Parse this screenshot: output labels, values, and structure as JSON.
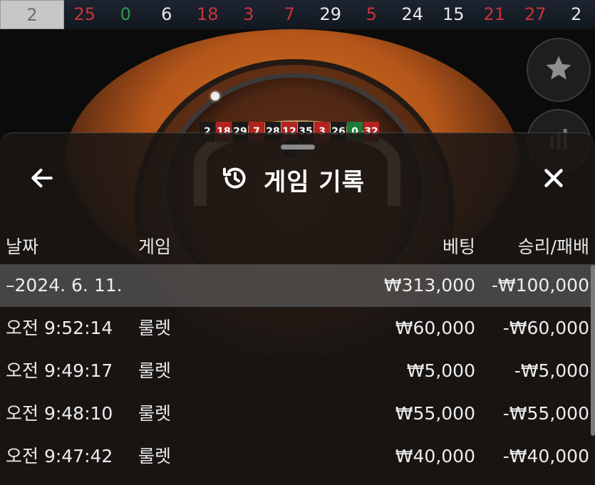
{
  "results_strip": {
    "numbers": [
      {
        "value": "2",
        "color": "grey"
      },
      {
        "value": "25",
        "color": "red"
      },
      {
        "value": "0",
        "color": "green"
      },
      {
        "value": "6",
        "color": "white"
      },
      {
        "value": "18",
        "color": "red"
      },
      {
        "value": "3",
        "color": "red"
      },
      {
        "value": "7",
        "color": "red"
      },
      {
        "value": "29",
        "color": "white"
      },
      {
        "value": "5",
        "color": "red"
      },
      {
        "value": "24",
        "color": "white"
      },
      {
        "value": "15",
        "color": "white"
      },
      {
        "value": "21",
        "color": "red"
      },
      {
        "value": "27",
        "color": "red"
      },
      {
        "value": "2",
        "color": "white"
      }
    ]
  },
  "wheel": {
    "pockets": [
      {
        "n": "2",
        "c": "b"
      },
      {
        "n": "18",
        "c": "r"
      },
      {
        "n": "29",
        "c": "b"
      },
      {
        "n": "7",
        "c": "r"
      },
      {
        "n": "28",
        "c": "b"
      },
      {
        "n": "12",
        "c": "r"
      },
      {
        "n": "35",
        "c": "b"
      },
      {
        "n": "3",
        "c": "r"
      },
      {
        "n": "26",
        "c": "b"
      },
      {
        "n": "0",
        "c": "g"
      },
      {
        "n": "32",
        "c": "r"
      }
    ]
  },
  "side_buttons": {
    "favorites_icon": "star-icon",
    "stats_icon": "bar-chart-icon"
  },
  "sheet": {
    "title": "게임 기록",
    "title_icon": "history-icon",
    "back_icon": "arrow-left-icon",
    "close_icon": "close-icon",
    "columns": {
      "date": "날짜",
      "game": "게임",
      "bet": "베팅",
      "win_loss": "승리/패배"
    },
    "date_group": {
      "label": "–2024. 6. 11.",
      "bet": "₩313,000",
      "win_loss": "-₩100,000"
    },
    "rows": [
      {
        "time": "오전 9:52:14",
        "game": "룰렛",
        "bet": "₩60,000",
        "win_loss": "-₩60,000"
      },
      {
        "time": "오전 9:49:17",
        "game": "룰렛",
        "bet": "₩5,000",
        "win_loss": "-₩5,000"
      },
      {
        "time": "오전 9:48:10",
        "game": "룰렛",
        "bet": "₩55,000",
        "win_loss": "-₩55,000"
      },
      {
        "time": "오전 9:47:42",
        "game": "룰렛",
        "bet": "₩40,000",
        "win_loss": "-₩40,000"
      }
    ]
  },
  "colors": {
    "red": "#c9343c",
    "green": "#2e9a4d",
    "sheet_bg": "#1a1614",
    "row_highlight": "#5a5a5a"
  }
}
